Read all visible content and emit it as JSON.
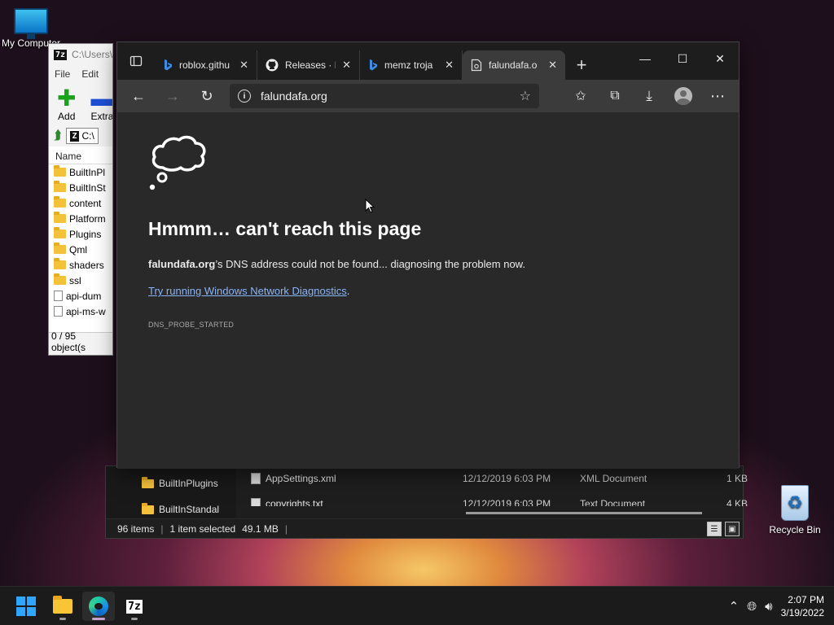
{
  "desktop": {
    "my_computer_label": "My Computer",
    "recycle_bin_label": "Recycle Bin"
  },
  "zip_window": {
    "title": "C:\\Users\\",
    "badge": "7z",
    "menu": [
      "File",
      "Edit"
    ],
    "add_label": "Add",
    "extract_label": "Extra",
    "address": "C:\\",
    "column_name": "Name",
    "rows": [
      {
        "name": "BuiltInPl",
        "type": "folder"
      },
      {
        "name": "BuiltInSt",
        "type": "folder"
      },
      {
        "name": "content",
        "type": "folder"
      },
      {
        "name": "Platform",
        "type": "folder"
      },
      {
        "name": "Plugins",
        "type": "folder"
      },
      {
        "name": "Qml",
        "type": "folder"
      },
      {
        "name": "shaders",
        "type": "folder"
      },
      {
        "name": "ssl",
        "type": "folder"
      },
      {
        "name": "api-dum",
        "type": "file"
      },
      {
        "name": "api-ms-w",
        "type": "file"
      }
    ],
    "status": "0 / 95 object(s"
  },
  "explorer_window": {
    "nav_items": [
      "BuiltInPlugins",
      "BuiltInStandal"
    ],
    "files": [
      {
        "name": "AppSettings.xml",
        "date": "12/12/2019 6:03 PM",
        "type": "XML Document",
        "size": "1 KB"
      },
      {
        "name": "copyrights.txt",
        "date": "12/12/2019 6:03 PM",
        "type": "Text Document",
        "size": "4 KB"
      }
    ],
    "status_items": "96 items",
    "status_selected": "1 item selected",
    "status_size": "49.1 MB"
  },
  "browser": {
    "tabs": [
      {
        "label": "roblox.githu",
        "icon": "bing-icon",
        "active": false
      },
      {
        "label": "Releases · F",
        "icon": "github-icon",
        "active": false
      },
      {
        "label": "memz troja",
        "icon": "bing-icon",
        "active": false
      },
      {
        "label": "falundafa.o",
        "icon": "error-page-icon",
        "active": true
      }
    ],
    "address": "falundafa.org",
    "error": {
      "title": "Hmmm… can't reach this page",
      "domain": "falundafa.org",
      "message_rest": "’s DNS address could not be found... diagnosing the problem now.",
      "link_text": "Try running Windows Network Diagnostics",
      "link_suffix": ".",
      "code": "DNS_PROBE_STARTED"
    }
  },
  "taskbar": {
    "time": "2:07 PM",
    "date": "3/19/2022",
    "seven_zip_label": "7z"
  },
  "colors": {
    "link": "#8ab4f8",
    "start_blue": "#2fa6ff",
    "page_bg": "#292929"
  }
}
